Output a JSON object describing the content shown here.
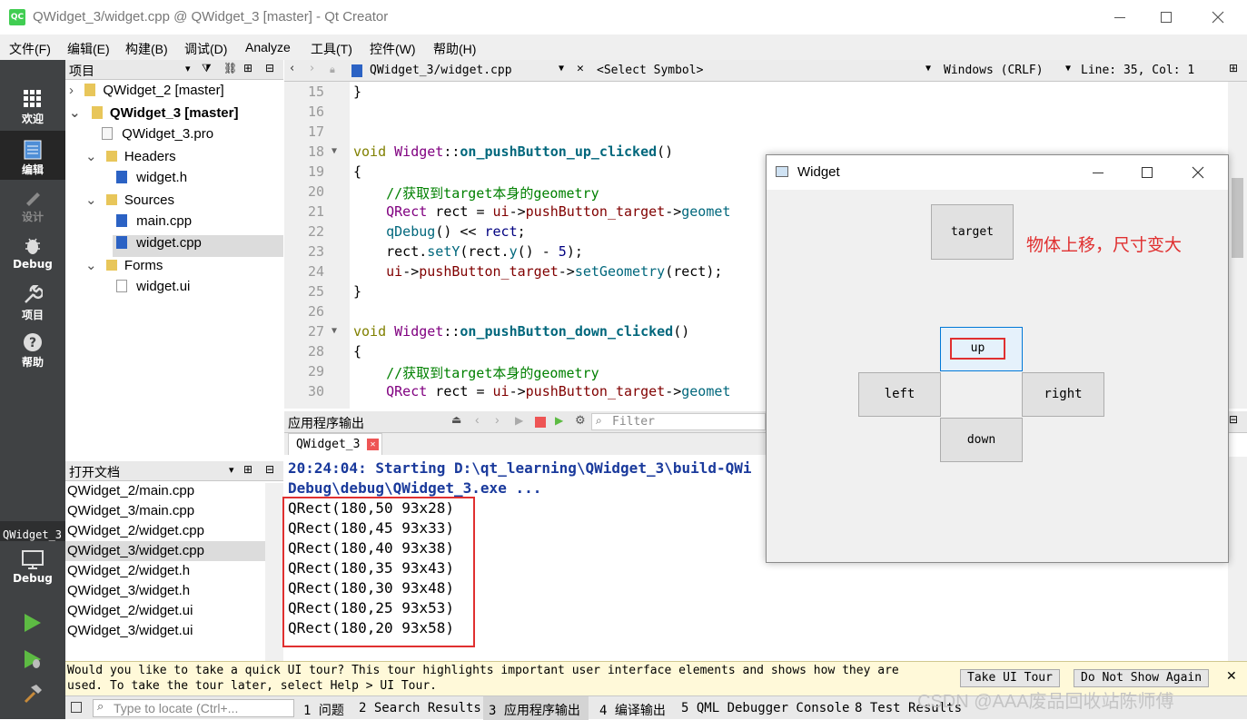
{
  "window": {
    "title": "QWidget_3/widget.cpp @ QWidget_3 [master] - Qt Creator",
    "app_icon": "QC",
    "accent": "#41cd52"
  },
  "menu": [
    "文件(F)",
    "编辑(E)",
    "构建(B)",
    "调试(D)",
    "Analyze",
    "工具(T)",
    "控件(W)",
    "帮助(H)"
  ],
  "modes": [
    {
      "label": "欢迎",
      "icon": "grid-icon"
    },
    {
      "label": "编辑",
      "icon": "edit-icon"
    },
    {
      "label": "设计",
      "icon": "pencil-icon"
    },
    {
      "label": "Debug",
      "icon": "bug-icon"
    },
    {
      "label": "项目",
      "icon": "wrench-icon"
    },
    {
      "label": "帮助",
      "icon": "help-icon"
    }
  ],
  "kit": {
    "project": "QWidget_3",
    "config": "Debug"
  },
  "projects_panel": {
    "title": "项目",
    "tree": [
      {
        "label": "QWidget_2 [master]"
      },
      {
        "label": "QWidget_3 [master]"
      },
      {
        "label": "QWidget_3.pro"
      },
      {
        "label": "Headers"
      },
      {
        "label": "widget.h"
      },
      {
        "label": "Sources"
      },
      {
        "label": "main.cpp"
      },
      {
        "label": "widget.cpp"
      },
      {
        "label": "Forms"
      },
      {
        "label": "widget.ui"
      }
    ]
  },
  "open_docs": {
    "title": "打开文档",
    "items": [
      "QWidget_2/main.cpp",
      "QWidget_3/main.cpp",
      "QWidget_2/widget.cpp",
      "QWidget_3/widget.cpp",
      "QWidget_2/widget.h",
      "QWidget_3/widget.h",
      "QWidget_2/widget.ui",
      "QWidget_3/widget.ui"
    ]
  },
  "editor": {
    "file": "QWidget_3/widget.cpp",
    "symbol": "<Select Symbol>",
    "line_ending": "Windows (CRLF)",
    "position": "Line: 35, Col: 1",
    "line_numbers": [
      "15",
      "16",
      "17",
      "18",
      "19",
      "20",
      "21",
      "22",
      "23",
      "24",
      "25",
      "26",
      "27",
      "28",
      "29",
      "30"
    ],
    "code": {
      "l15": "}",
      "l18_kw": "void ",
      "l18_cls": "Widget",
      "l18_sep": "::",
      "l18_fn": "on_pushButton_up_clicked",
      "l18_end": "()",
      "l19": "{",
      "l20": "    //获取到target本身的geometry",
      "l21_a": "    QRect",
      "l21_b": " rect = ",
      "l21_c": "ui",
      "l21_d": "->",
      "l21_e": "pushButton_target",
      "l21_f": "->",
      "l21_g": "geomet",
      "l22_a": "    qDebug",
      "l22_b": "() << ",
      "l22_c": "rect",
      "l22_d": ";",
      "l23_a": "    rect.",
      "l23_b": "setY",
      "l23_c": "(rect.",
      "l23_d": "y",
      "l23_e": "() - ",
      "l23_f": "5",
      "l23_g": ");",
      "l24_a": "    ui",
      "l24_b": "->",
      "l24_c": "pushButton_target",
      "l24_d": "->",
      "l24_e": "setGeometry",
      "l24_f": "(rect);",
      "l25": "}",
      "l27_kw": "void ",
      "l27_cls": "Widget",
      "l27_sep": "::",
      "l27_fn": "on_pushButton_down_clicked",
      "l27_end": "()",
      "l28": "{",
      "l29": "    //获取到target本身的geometry",
      "l30_a": "    QRect",
      "l30_b": " rect = ",
      "l30_c": "ui",
      "l30_d": "->",
      "l30_e": "pushButton_target",
      "l30_f": "->",
      "l30_g": "geomet"
    }
  },
  "output_panel": {
    "title": "应用程序输出",
    "filter_placeholder": "Filter",
    "tab": "QWidget_3",
    "start_line1": "20:24:04: Starting D:\\qt_learning\\QWidget_3\\build-QWi",
    "start_line2": "Debug\\debug\\QWidget_3.exe ...",
    "lines": [
      "QRect(180,50 93x28)",
      "QRect(180,45 93x33)",
      "QRect(180,40 93x38)",
      "QRect(180,35 93x43)",
      "QRect(180,30 93x48)",
      "QRect(180,25 93x53)",
      "QRect(180,20 93x58)"
    ]
  },
  "widget_window": {
    "title": "Widget",
    "buttons": {
      "target": "target",
      "up": "up",
      "left": "left",
      "right": "right",
      "down": "down"
    },
    "annotation": "物体上移，尺寸变大",
    "annotation_color": "#e03030"
  },
  "tour": {
    "line1": "Would you like to take a quick UI tour? This tour highlights important user interface elements and shows how they are",
    "line2": "used. To take the tour later, select Help > UI Tour.",
    "take": "Take UI Tour",
    "dismiss": "Do Not Show Again"
  },
  "statusbar": {
    "locate_placeholder": "Type to locate (Ctrl+...",
    "tabs": [
      "1 问题",
      "2 Search Results",
      "3 应用程序输出",
      "4 编译输出",
      "5 QML Debugger Console",
      "8 Test Results"
    ]
  },
  "watermark": "CSDN @AAA废品回收站陈师傅"
}
